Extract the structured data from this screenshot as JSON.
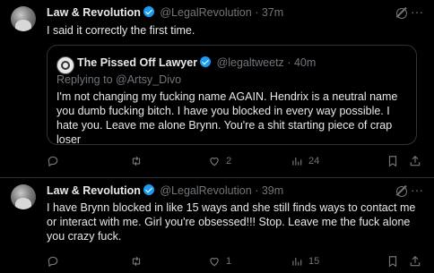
{
  "tweets": [
    {
      "author_name": "Law & Revolution",
      "handle": "@LegalRevolution",
      "separator": "·",
      "time": "37m",
      "text": "I said it correctly the first time.",
      "quote": {
        "author_name": "The Pissed Off Lawyer",
        "handle": "@legaltweetz",
        "separator": "·",
        "time": "40m",
        "replying_to_prefix": "Replying to ",
        "replying_to_handle": "@Artsy_Divo",
        "text": "I'm not changing my fucking name AGAIN. Hendrix is a neutral name you dumb fucking bitch. I have you blocked in every way possible. I hate you. Leave me alone Brynn. You're a shit starting piece of crap loser"
      },
      "reply_count": "",
      "retweet_count": "",
      "like_count": "2",
      "view_count": "24",
      "more_label": "···"
    },
    {
      "author_name": "Law & Revolution",
      "handle": "@LegalRevolution",
      "separator": "·",
      "time": "39m",
      "text": "I have Brynn blocked in like 15 ways and she still finds ways to contact me or interact with me. Girl you're obsessed!!! Stop. Leave me the fuck alone you crazy fuck.",
      "reply_count": "",
      "retweet_count": "",
      "like_count": "1",
      "view_count": "15",
      "more_label": "···"
    }
  ],
  "colors": {
    "background": "#000000",
    "text": "#e7e9ea",
    "secondary": "#71767b",
    "verified": "#1d9bf0",
    "border": "#2f3336"
  },
  "icons": [
    "reply-icon",
    "retweet-icon",
    "like-icon",
    "views-icon",
    "bookmark-icon",
    "share-icon",
    "grok-icon",
    "more-icon",
    "verified-badge-icon"
  ]
}
